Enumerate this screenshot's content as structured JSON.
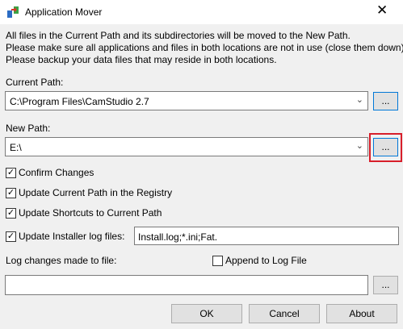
{
  "window": {
    "title": "Application Mover",
    "close_glyph": "✕"
  },
  "description": {
    "line1": "All files in the Current Path and its subdirectories will be moved to the New Path.",
    "line2": "Please make sure all applications and files in both locations are not in use (close them down).",
    "line3": "Please backup your data files that may reside in both locations."
  },
  "current_path": {
    "label": "Current Path:",
    "value": "C:\\Program Files\\CamStudio 2.7",
    "browse_label": "..."
  },
  "new_path": {
    "label": "New Path:",
    "value": "E:\\",
    "browse_label": "..."
  },
  "options": {
    "confirm_changes": {
      "label": "Confirm Changes",
      "checked": true
    },
    "update_registry": {
      "label": "Update Current Path in the Registry",
      "checked": true
    },
    "update_shortcuts": {
      "label": "Update Shortcuts to Current Path",
      "checked": true
    },
    "update_installer_logs": {
      "label": "Update Installer log files:",
      "checked": true,
      "value": "Install.log;*.ini;Fat."
    }
  },
  "log": {
    "label": "Log changes made to file:",
    "append_label": "Append to Log File",
    "append_checked": false,
    "value": "",
    "browse_label": "..."
  },
  "buttons": {
    "ok": "OK",
    "cancel": "Cancel",
    "about": "About"
  },
  "glyphs": {
    "check": "✓",
    "arrow": "⌄"
  },
  "colors": {
    "highlight": "#d81e2a",
    "focus_border": "#0078d7"
  }
}
